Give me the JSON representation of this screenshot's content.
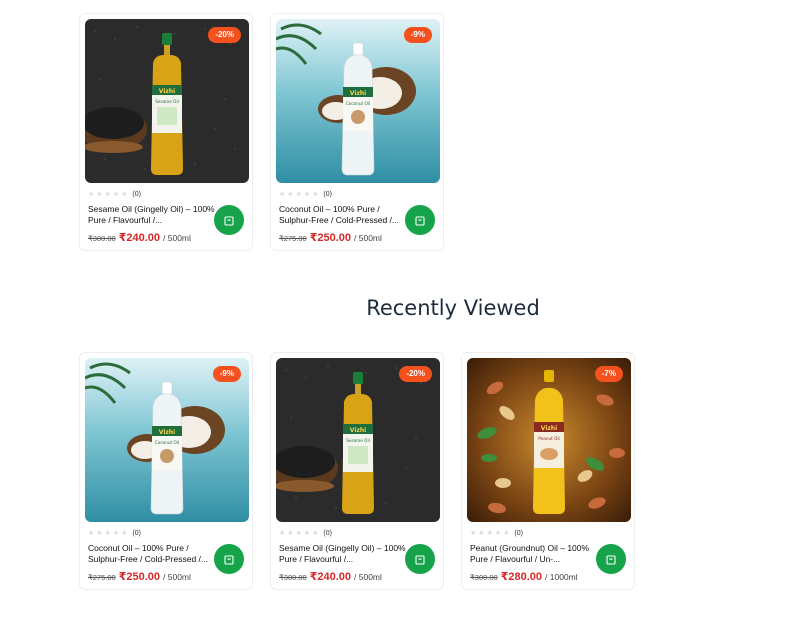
{
  "sections": {
    "recently_viewed_heading": "Recently Viewed"
  },
  "top_products": [
    {
      "name": "Sesame Oil (Gingelly Oil) – 100% Pure / Flavourful /...",
      "discount": "-20%",
      "rating_count": "(0)",
      "old_price": "₹300.00",
      "new_price": "₹240.00",
      "unit": "/ 500ml",
      "image_theme": "sesame"
    },
    {
      "name": "Coconut Oil – 100% Pure / Sulphur-Free / Cold-Pressed /...",
      "discount": "-9%",
      "rating_count": "(0)",
      "old_price": "₹275.00",
      "new_price": "₹250.00",
      "unit": "/ 500ml",
      "image_theme": "coconut"
    }
  ],
  "recently_viewed": [
    {
      "name": "Coconut Oil – 100% Pure / Sulphur-Free / Cold-Pressed /...",
      "discount": "-9%",
      "rating_count": "(0)",
      "old_price": "₹275.00",
      "new_price": "₹250.00",
      "unit": "/ 500ml",
      "image_theme": "coconut"
    },
    {
      "name": "Sesame Oil (Gingelly Oil) – 100% Pure / Flavourful /...",
      "discount": "-20%",
      "rating_count": "(0)",
      "old_price": "₹300.00",
      "new_price": "₹240.00",
      "unit": "/ 500ml",
      "image_theme": "sesame"
    },
    {
      "name": "Peanut (Groundnut) Oil – 100% Pure / Flavourful / Un-...",
      "discount": "-7%",
      "rating_count": "(0)",
      "old_price": "₹300.00",
      "new_price": "₹280.00",
      "unit": "/ 1000ml",
      "image_theme": "peanut"
    }
  ],
  "brand_label": "Vizhi",
  "colors": {
    "accent_green": "#16a34a",
    "discount_badge": "#f4511e",
    "price_red": "#d62828"
  },
  "icons": {
    "cart": "shopping-bag-icon",
    "star": "star-icon"
  }
}
